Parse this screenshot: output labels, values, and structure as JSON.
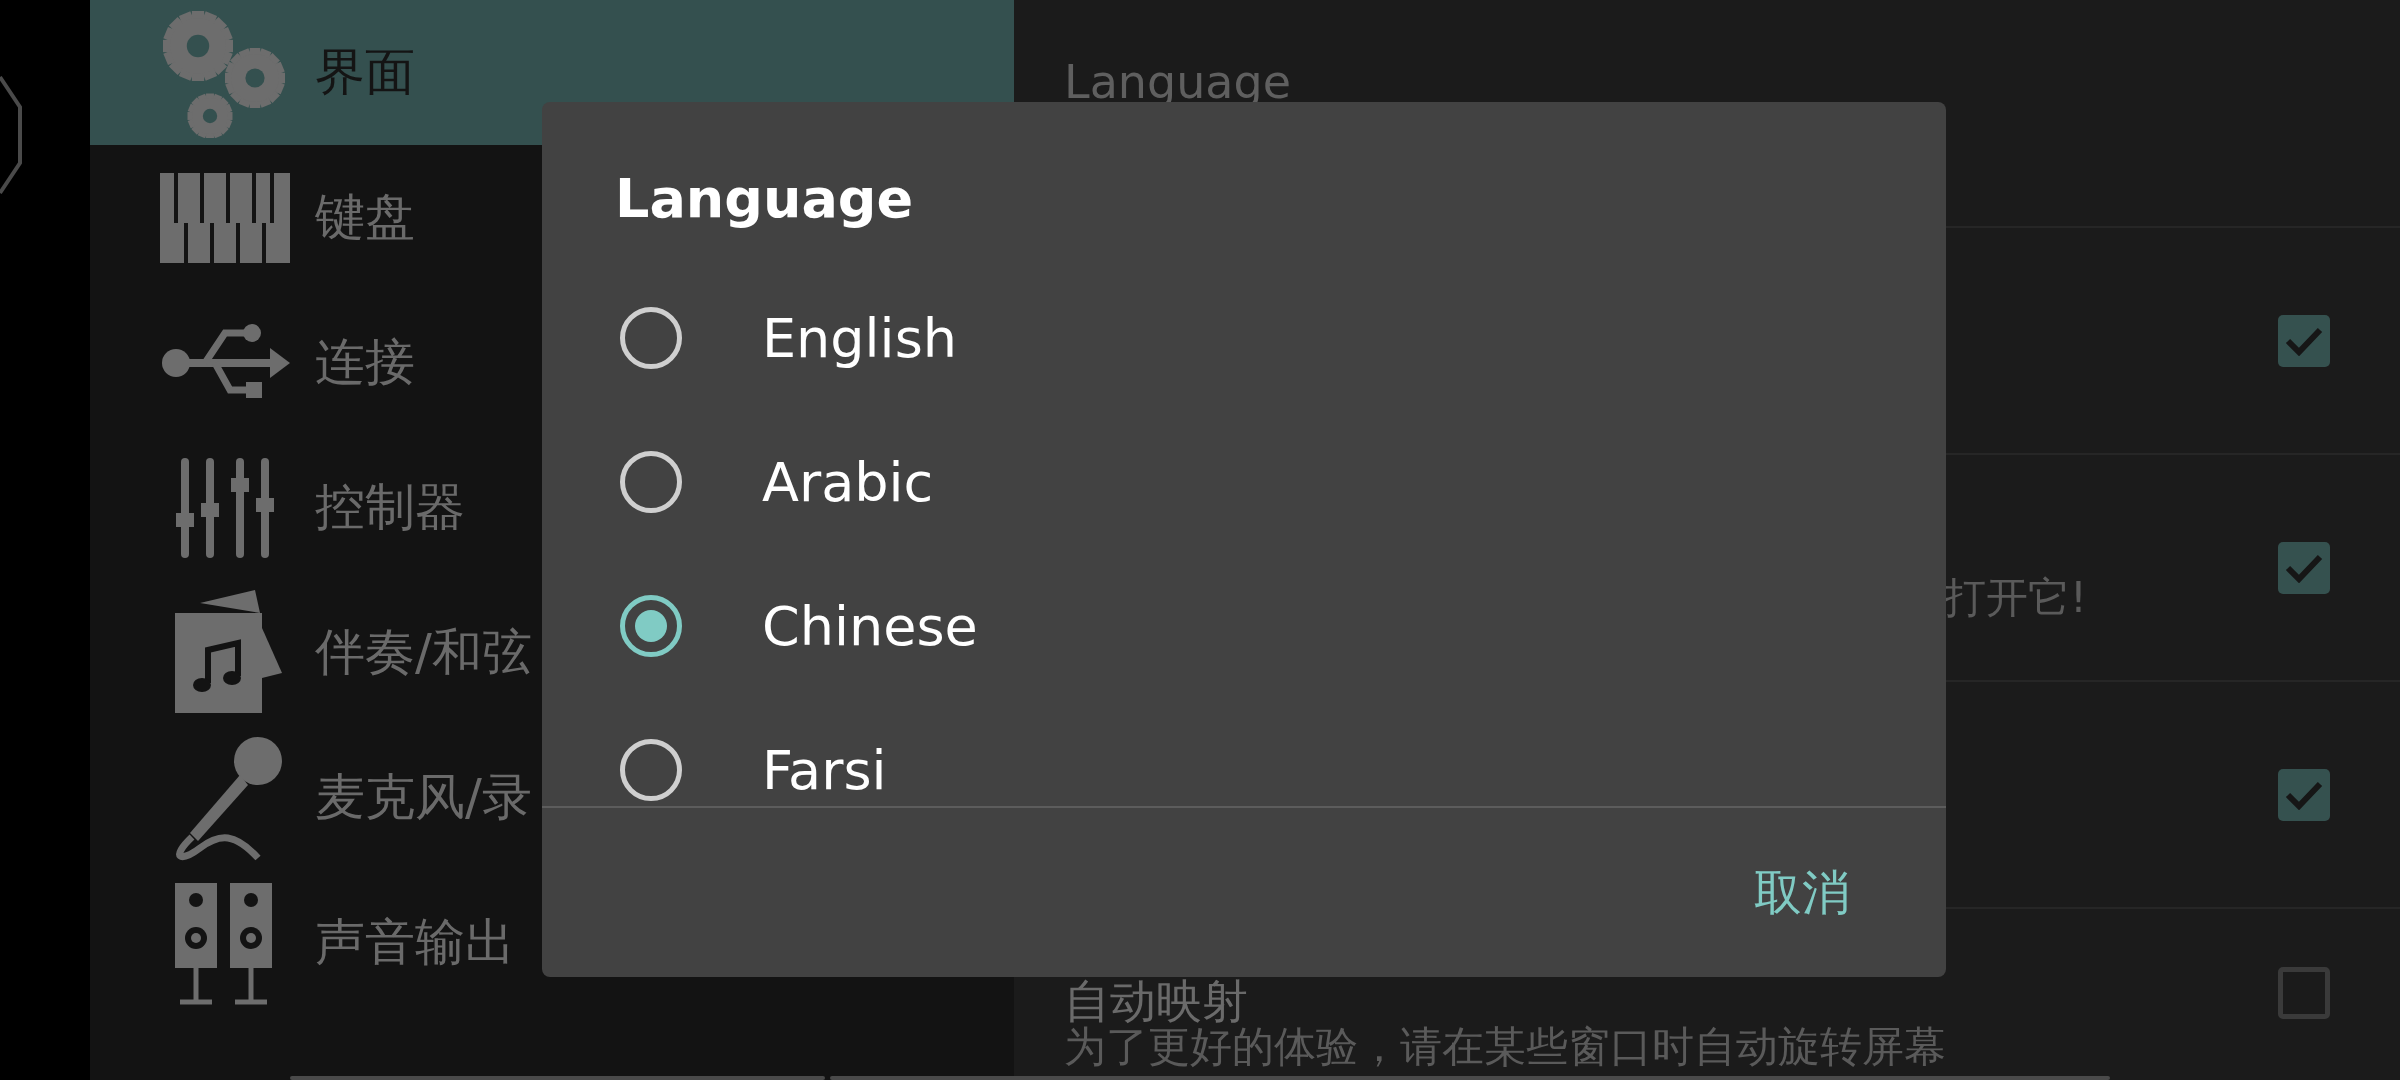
{
  "sidebar": {
    "items": [
      {
        "label": "界面",
        "selected": true
      },
      {
        "label": "键盘",
        "selected": false
      },
      {
        "label": "连接",
        "selected": false
      },
      {
        "label": "控制器",
        "selected": false
      },
      {
        "label": "伴奏/和弦",
        "selected": false
      },
      {
        "label": "麦克风/录",
        "selected": false
      },
      {
        "label": "声音输出",
        "selected": false
      }
    ]
  },
  "settings": {
    "header": "Language",
    "rows": [
      {
        "checked": true
      },
      {
        "subtitle": "打开它!",
        "checked": true
      },
      {
        "checked": true
      },
      {
        "title": "自动映射",
        "subtitle": "为了更好的体验，请在某些窗口时自动旋转屏幕",
        "checked": false
      }
    ]
  },
  "dialog": {
    "title": "Language",
    "options": [
      {
        "label": "English",
        "selected": false
      },
      {
        "label": "Arabic",
        "selected": false
      },
      {
        "label": "Chinese",
        "selected": true
      },
      {
        "label": "Farsi",
        "selected": false
      }
    ],
    "buttons": [
      "取消"
    ]
  }
}
